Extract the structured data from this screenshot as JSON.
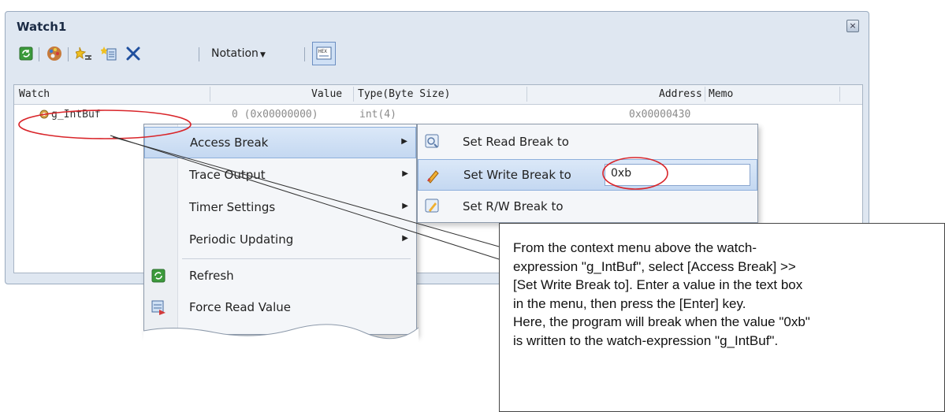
{
  "window": {
    "title": "Watch1",
    "close_glyph": "×"
  },
  "toolbar": {
    "buttons": [
      {
        "name": "refresh-icon"
      },
      {
        "name": "color-palette-icon"
      },
      {
        "name": "add-watch-icon"
      },
      {
        "name": "new-category-icon"
      },
      {
        "name": "delete-icon"
      }
    ],
    "notation_label": "Notation",
    "toggle_icon": "hex-display-icon"
  },
  "grid": {
    "columns": [
      "Watch",
      "Value",
      "Type(Byte Size)",
      "Address",
      "Memo"
    ],
    "rows": [
      {
        "watch": "g_IntBuf",
        "value": "0 (0x00000000)",
        "type": "int(4)",
        "address": "0x00000430",
        "memo": ""
      }
    ]
  },
  "context_menu": {
    "items": [
      {
        "label": "Access Break",
        "has_submenu": true,
        "highlighted": true
      },
      {
        "label": "Trace Output",
        "has_submenu": true
      },
      {
        "label": "Timer Settings",
        "has_submenu": true
      },
      {
        "label": "Periodic Updating",
        "has_submenu": true
      },
      {
        "label": "Refresh",
        "icon": "refresh-icon"
      },
      {
        "label": "Force Read Value",
        "icon": "force-read-icon"
      }
    ]
  },
  "submenu": {
    "items": [
      {
        "label": "Set Read Break to",
        "icon": "read-break-icon"
      },
      {
        "label": "Set Write Break to",
        "icon": "write-break-icon",
        "highlighted": true,
        "input_value": "0xb"
      },
      {
        "label": "Set R/W Break to",
        "icon": "rw-break-icon"
      }
    ]
  },
  "callout": {
    "lines": [
      "From the context menu above the watch-",
      "expression \"g_IntBuf\", select [Access Break] >>",
      "[Set Write Break to]. Enter a value in the text box",
      "in the menu, then press the [Enter] key.",
      "Here, the program will break when the value \"0xb\"",
      "is written to the watch-expression \"g_IntBuf\"."
    ]
  },
  "colors": {
    "annotation_red": "#d9252a",
    "highlight": "#c4d8f1"
  }
}
